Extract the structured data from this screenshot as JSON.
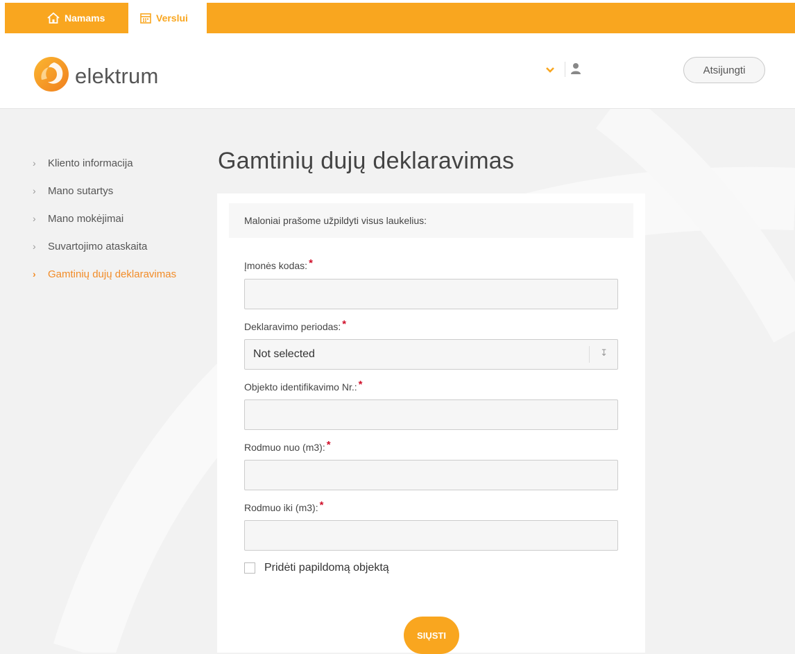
{
  "topbar": {
    "home_tab": "Namams",
    "business_tab": "Verslui"
  },
  "header": {
    "logo_text": "elektrum",
    "logout_label": "Atsijungti"
  },
  "sidebar": {
    "items": [
      {
        "label": "Kliento informacija",
        "active": false
      },
      {
        "label": "Mano sutartys",
        "active": false
      },
      {
        "label": "Mano mokėjimai",
        "active": false
      },
      {
        "label": "Suvartojimo ataskaita",
        "active": false
      },
      {
        "label": "Gamtinių dujų deklaravimas",
        "active": true
      }
    ]
  },
  "page": {
    "title": "Gamtinių dujų deklaravimas"
  },
  "form": {
    "intro": "Maloniai prašome užpildyti visus laukelius:",
    "fields": [
      {
        "label": "Įmonės kodas:",
        "value": ""
      },
      {
        "label": "Deklaravimo periodas:",
        "value": "Not selected"
      },
      {
        "label": "Objekto identifikavimo Nr.:",
        "value": ""
      },
      {
        "label": "Rodmuo nuo (m3):",
        "value": ""
      },
      {
        "label": "Rodmuo iki (m3):",
        "value": ""
      }
    ],
    "required_mark": "*",
    "checkbox_label": "Pridėti papildomą objektą",
    "submit_label": "SIŲSTI"
  },
  "colors": {
    "accent": "#f9a61f",
    "active_nav": "#f28c28",
    "required": "#d0112b"
  }
}
